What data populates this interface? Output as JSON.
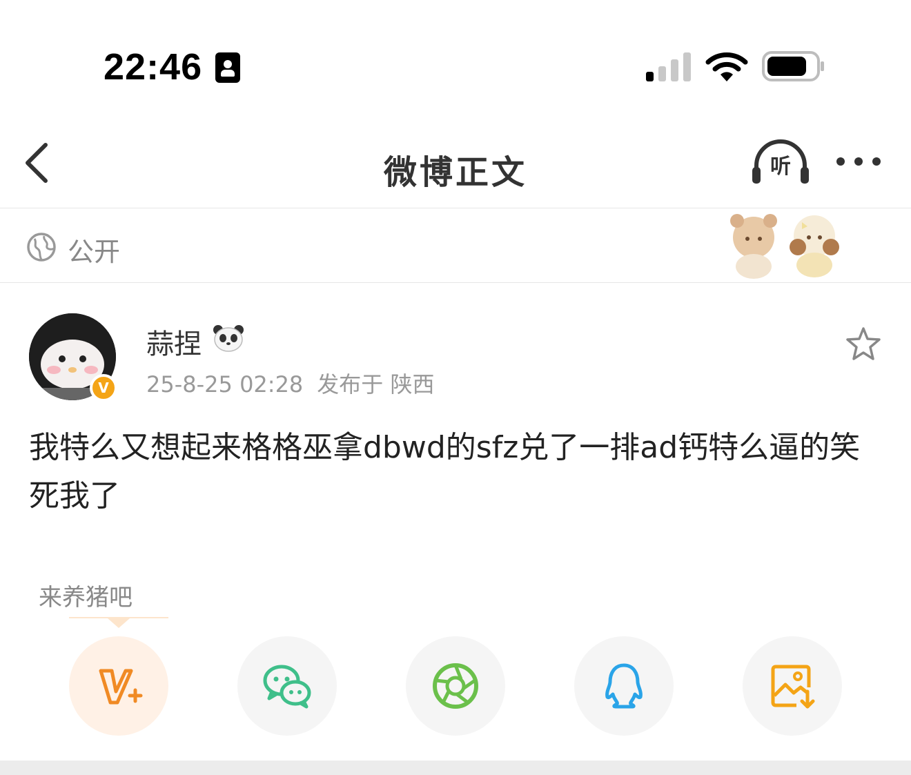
{
  "status_bar": {
    "time": "22:46",
    "icons": [
      "id-card-icon",
      "cellular-signal-icon",
      "wifi-icon",
      "battery-icon"
    ]
  },
  "nav_bar": {
    "title": "微博正文",
    "listen_label": "听",
    "icons": [
      "back-icon",
      "listen-headphones-icon",
      "more-icon"
    ]
  },
  "visibility": {
    "label": "公开",
    "icon": "globe-icon"
  },
  "post": {
    "author": "蒜捏",
    "author_emoji": "panda-icon",
    "verified_badge": "V",
    "timestamp": "25-8-25 02:28",
    "location": "发布于 陕西",
    "text": "我特么又想起来格格巫拿dbwd的sfz兑了一排ad钙特么逼的笑死我了"
  },
  "share": {
    "tooltip": "来养猪吧",
    "buttons": [
      {
        "name": "vplus",
        "icon": "vplus-icon",
        "color": "#f08a24"
      },
      {
        "name": "wechat",
        "icon": "wechat-icon",
        "color": "#3fbf8a"
      },
      {
        "name": "moments",
        "icon": "moments-aperture-icon",
        "color": "#6bc04b"
      },
      {
        "name": "qq",
        "icon": "qq-icon",
        "color": "#2aa4e8"
      },
      {
        "name": "save-image",
        "icon": "save-image-icon",
        "color": "#f4a416"
      }
    ]
  },
  "colors": {
    "accent_orange": "#f08a24",
    "verify_gold": "#f4a416",
    "text_gray": "#999999"
  }
}
